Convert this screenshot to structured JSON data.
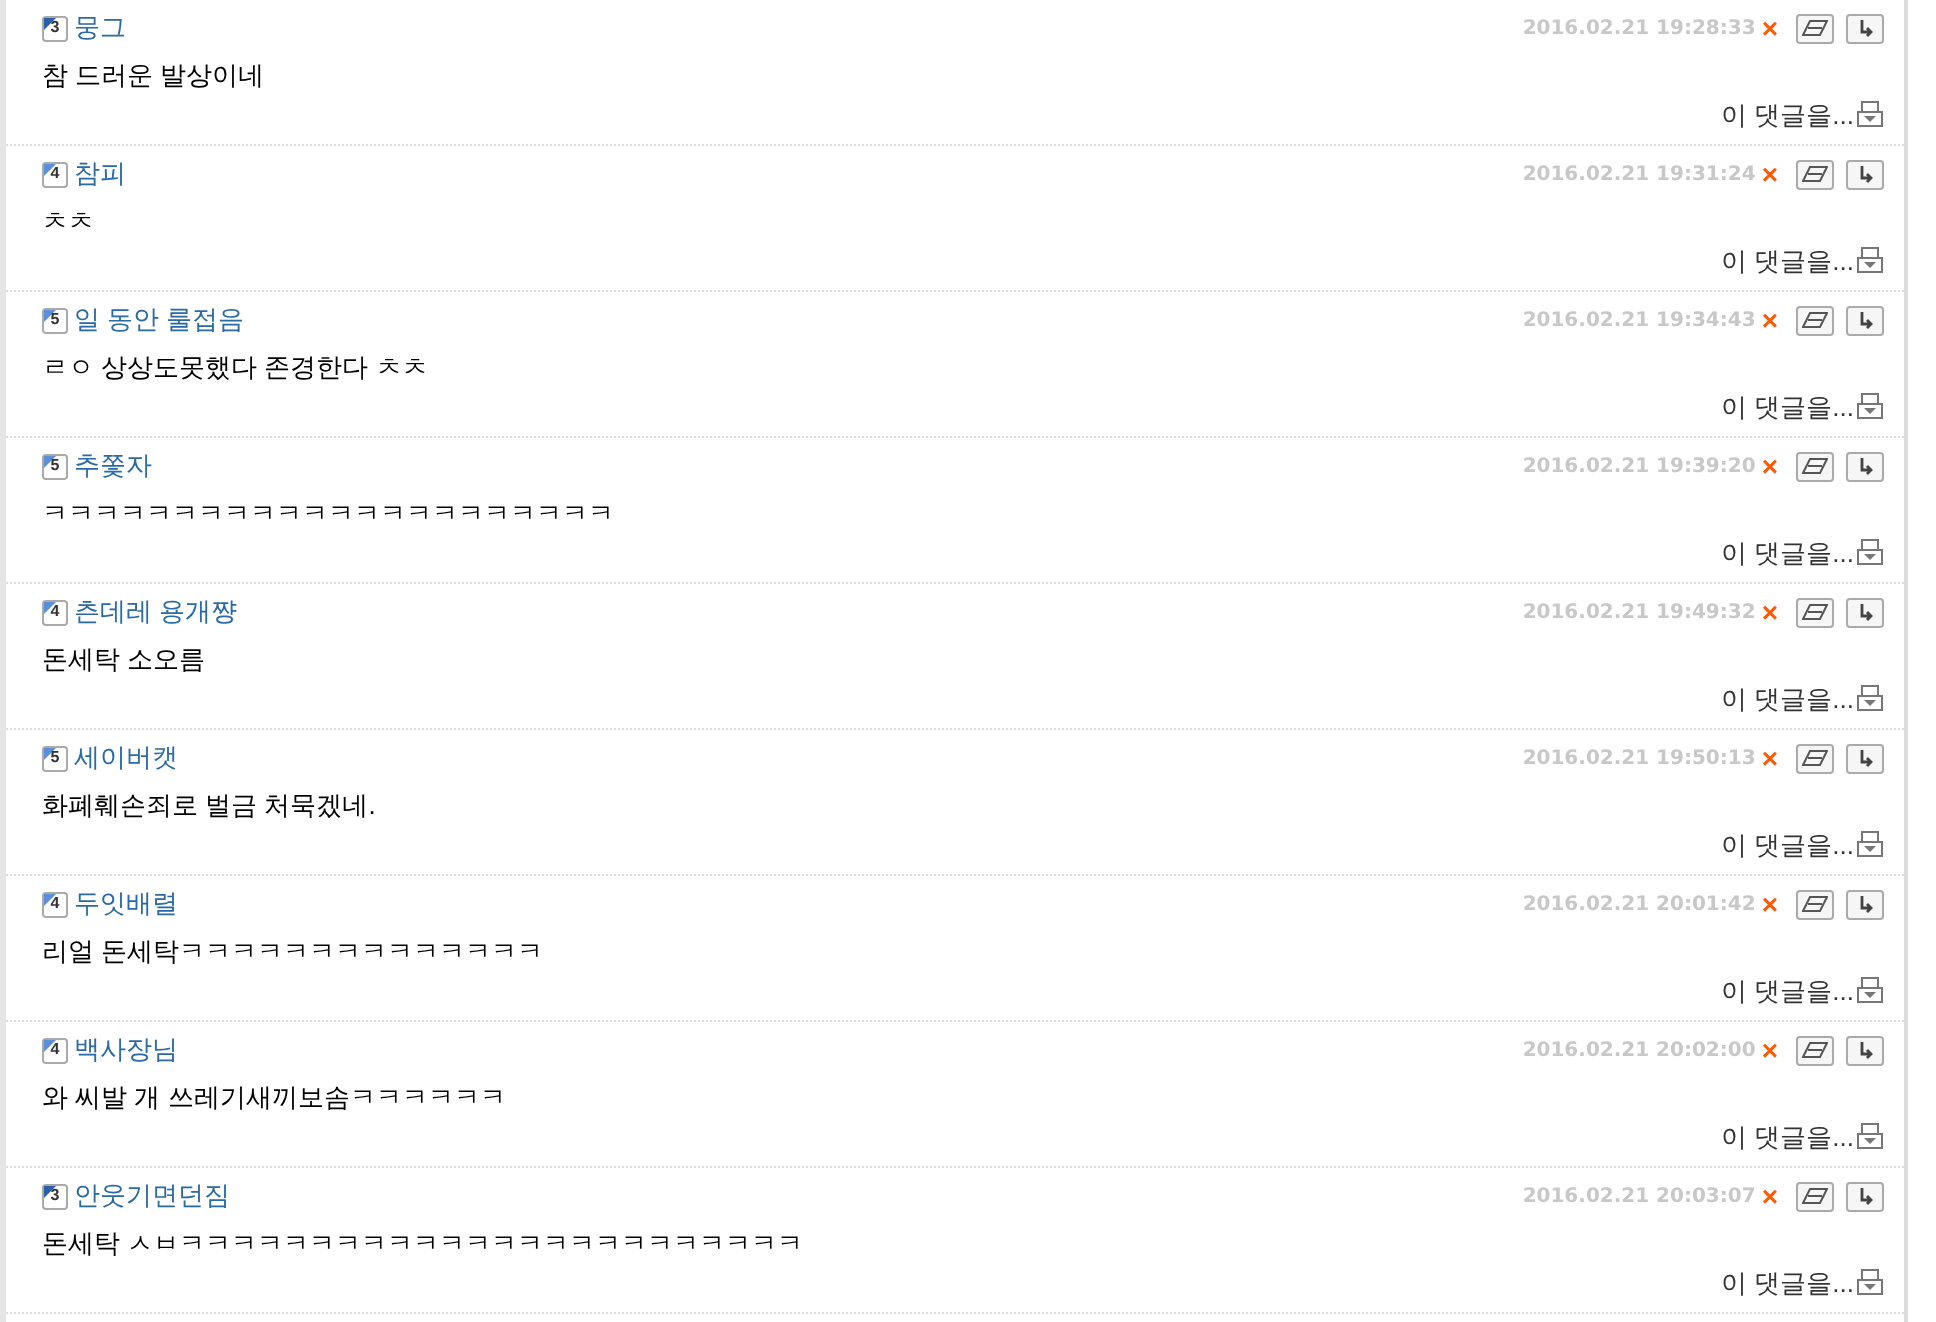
{
  "comments": [
    {
      "level": "3",
      "color": "#2c5fa8",
      "nickname": "뭉그",
      "time": "2016.02.21 19:28:33",
      "delete": "×",
      "text": "참 드러운 발상이네",
      "more": "이 댓글을..."
    },
    {
      "level": "4",
      "color": "#5b8fd8",
      "nickname": "참피",
      "time": "2016.02.21 19:31:24",
      "delete": "×",
      "text": "ㅊㅊ",
      "more": "이 댓글을..."
    },
    {
      "level": "5",
      "color": "#5b8fd8",
      "nickname": "일 동안 룰접음",
      "time": "2016.02.21 19:34:43",
      "delete": "×",
      "text": "ㄹㅇ 상상도못했다 존경한다 ㅊㅊ",
      "more": "이 댓글을..."
    },
    {
      "level": "5",
      "color": "#5b8fd8",
      "nickname": "추쫓자",
      "time": "2016.02.21 19:39:20",
      "delete": "×",
      "text": "ㅋㅋㅋㅋㅋㅋㅋㅋㅋㅋㅋㅋㅋㅋㅋㅋㅋㅋㅋㅋㅋㅋ",
      "more": "이 댓글을..."
    },
    {
      "level": "4",
      "color": "#5b8fd8",
      "nickname": "츤데레 용개쨩",
      "time": "2016.02.21 19:49:32",
      "delete": "×",
      "text": "돈세탁 소오름",
      "more": "이 댓글을..."
    },
    {
      "level": "5",
      "color": "#5b8fd8",
      "nickname": "세이버캣",
      "time": "2016.02.21 19:50:13",
      "delete": "×",
      "text": "화폐훼손죄로 벌금 처묵겠네.",
      "more": "이 댓글을..."
    },
    {
      "level": "4",
      "color": "#5b8fd8",
      "nickname": "두잇배렬",
      "time": "2016.02.21 20:01:42",
      "delete": "×",
      "text": "리얼 돈세탁ㅋㅋㅋㅋㅋㅋㅋㅋㅋㅋㅋㅋㅋㅋ",
      "more": "이 댓글을..."
    },
    {
      "level": "4",
      "color": "#5b8fd8",
      "nickname": "백사장님",
      "time": "2016.02.21 20:02:00",
      "delete": "×",
      "text": "와 씨발 개 쓰레기새끼보솜ㅋㅋㅋㅋㅋㅋ",
      "more": "이 댓글을..."
    },
    {
      "level": "3",
      "color": "#2c5fa8",
      "nickname": "안웃기면던짐",
      "time": "2016.02.21 20:03:07",
      "delete": "×",
      "text": "돈세탁 ㅅㅂㅋㅋㅋㅋㅋㅋㅋㅋㅋㅋㅋㅋㅋㅋㅋㅋㅋㅋㅋㅋㅋㅋㅋㅋ",
      "more": "이 댓글을..."
    }
  ]
}
